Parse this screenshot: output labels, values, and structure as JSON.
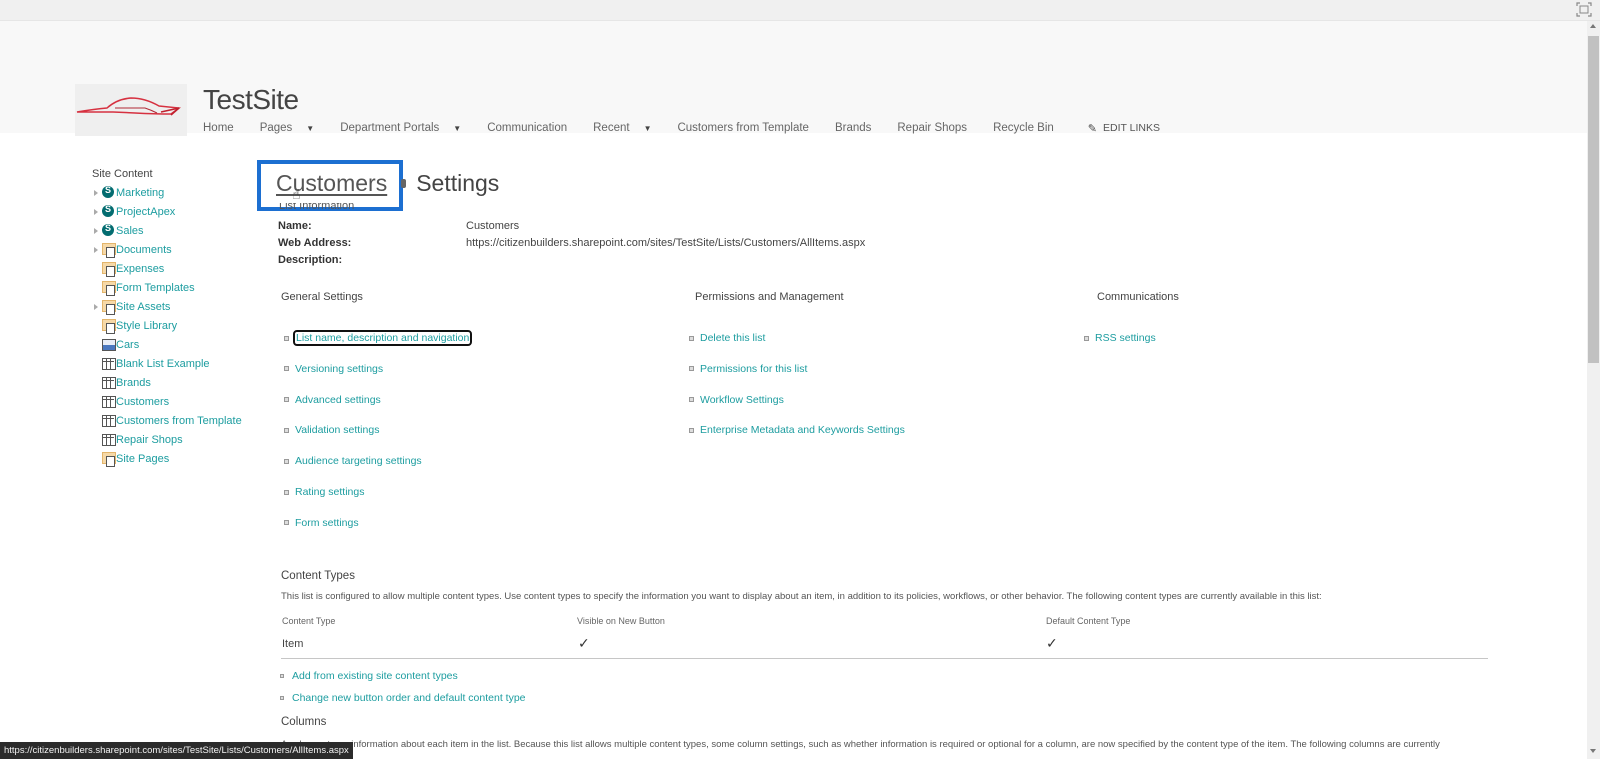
{
  "browser": {
    "fullscreen_icon": "fullscreen-icon"
  },
  "header": {
    "site_title": "TestSite",
    "logo_icon": "car-logo-icon",
    "nav": [
      {
        "label": "Home",
        "has_dropdown": false
      },
      {
        "label": "Pages",
        "has_dropdown": true
      },
      {
        "label": "Department Portals",
        "has_dropdown": true
      },
      {
        "label": "Communication",
        "has_dropdown": false
      },
      {
        "label": "Recent",
        "has_dropdown": true
      },
      {
        "label": "Customers from Template",
        "has_dropdown": false
      },
      {
        "label": "Brands",
        "has_dropdown": false
      },
      {
        "label": "Repair Shops",
        "has_dropdown": false
      },
      {
        "label": "Recycle Bin",
        "has_dropdown": false
      }
    ],
    "edit_links_label": "EDIT LINKS",
    "edit_links_icon": "pencil-icon"
  },
  "quicklaunch": {
    "heading": "Site Content",
    "items": [
      {
        "label": "Marketing",
        "icon": "subsite-icon",
        "expandable": true
      },
      {
        "label": "ProjectApex",
        "icon": "subsite-icon",
        "expandable": true
      },
      {
        "label": "Sales",
        "icon": "subsite-icon",
        "expandable": true
      },
      {
        "label": "Documents",
        "icon": "document-library-icon",
        "expandable": true
      },
      {
        "label": "Expenses",
        "icon": "document-library-icon",
        "expandable": false
      },
      {
        "label": "Form Templates",
        "icon": "document-library-icon",
        "expandable": false
      },
      {
        "label": "Site Assets",
        "icon": "document-library-icon",
        "expandable": true
      },
      {
        "label": "Style Library",
        "icon": "document-library-icon",
        "expandable": false
      },
      {
        "label": "Cars",
        "icon": "picture-library-icon",
        "expandable": false
      },
      {
        "label": "Blank List Example",
        "icon": "list-icon",
        "expandable": false
      },
      {
        "label": "Brands",
        "icon": "list-icon",
        "expandable": false
      },
      {
        "label": "Customers",
        "icon": "list-icon",
        "expandable": false
      },
      {
        "label": "Customers from Template",
        "icon": "list-icon",
        "expandable": false
      },
      {
        "label": "Repair Shops",
        "icon": "list-icon",
        "expandable": false
      },
      {
        "label": "Site Pages",
        "icon": "document-library-icon",
        "expandable": false
      }
    ]
  },
  "page": {
    "breadcrumb_link": "Customers",
    "breadcrumb_current": "Settings",
    "list_information_heading": "List Information",
    "info": {
      "name_label": "Name:",
      "name_value": "Customers",
      "web_address_label": "Web Address:",
      "web_address_value": "https://citizenbuilders.sharepoint.com/sites/TestSite/Lists/Customers/AllItems.aspx",
      "description_label": "Description:",
      "description_value": ""
    }
  },
  "settings": {
    "general": {
      "heading": "General Settings",
      "links": [
        "List name, description and navigation",
        "Versioning settings",
        "Advanced settings",
        "Validation settings",
        "Audience targeting settings",
        "Rating settings",
        "Form settings"
      ]
    },
    "permissions": {
      "heading": "Permissions and Management",
      "links": [
        "Delete this list",
        "Permissions for this list",
        "Workflow Settings",
        "Enterprise Metadata and Keywords Settings"
      ]
    },
    "communications": {
      "heading": "Communications",
      "links": [
        "RSS settings"
      ]
    }
  },
  "content_types": {
    "heading": "Content Types",
    "description": "This list is configured to allow multiple content types. Use content types to specify the information you want to display about an item, in addition to its policies, workflows, or other behavior. The following content types are currently available in this list:",
    "columns": [
      "Content Type",
      "Visible on New Button",
      "Default Content Type"
    ],
    "rows": [
      {
        "name": "Item",
        "visible_on_new_button": true,
        "default": true
      }
    ],
    "check_glyph": "✓",
    "links": [
      "Add from existing site content types",
      "Change new button order and default content type"
    ]
  },
  "columns_section": {
    "heading": "Columns",
    "description": "A column stores information about each item in the list. Because this list allows multiple content types, some column settings, such as whether information is required or optional for a column, are now specified by the content type of the item. The following columns are currently"
  },
  "status_bar": {
    "url": "https://citizenbuilders.sharepoint.com/sites/TestSite/Lists/Customers/AllItems.aspx"
  }
}
